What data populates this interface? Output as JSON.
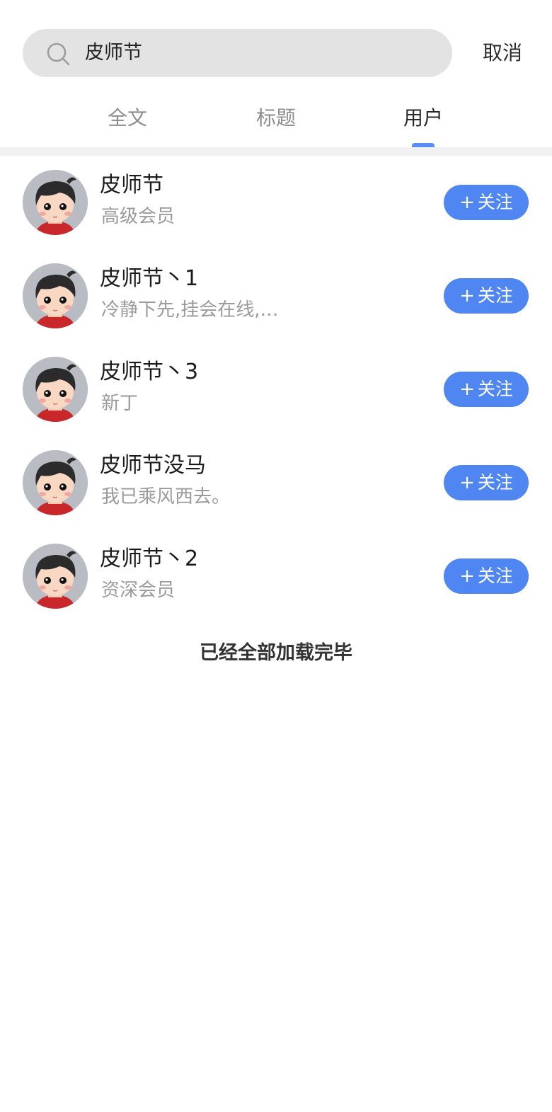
{
  "search": {
    "query": "皮师节",
    "cancel_label": "取消",
    "icon": "search-icon"
  },
  "tabs": [
    {
      "label": "全文",
      "active": false
    },
    {
      "label": "标题",
      "active": false
    },
    {
      "label": "用户",
      "active": true
    }
  ],
  "users": [
    {
      "name": "皮师节",
      "desc": "高级会员",
      "follow_label": "关注"
    },
    {
      "name": "皮师节丶1",
      "desc": "冷静下先,挂会在线,…",
      "follow_label": "关注"
    },
    {
      "name": "皮师节丶3",
      "desc": "新丁",
      "follow_label": "关注"
    },
    {
      "name": "皮师节没马",
      "desc": "我已乘风西去。",
      "follow_label": "关注"
    },
    {
      "name": "皮师节丶2",
      "desc": "资深会员",
      "follow_label": "关注"
    }
  ],
  "footer": {
    "text": "已经全部加载完毕"
  },
  "colors": {
    "accent": "#4f86f2",
    "tab_indicator": "#5a8ef3",
    "search_bg": "#e3e3e3",
    "secondary_text": "#9a9a9a"
  }
}
